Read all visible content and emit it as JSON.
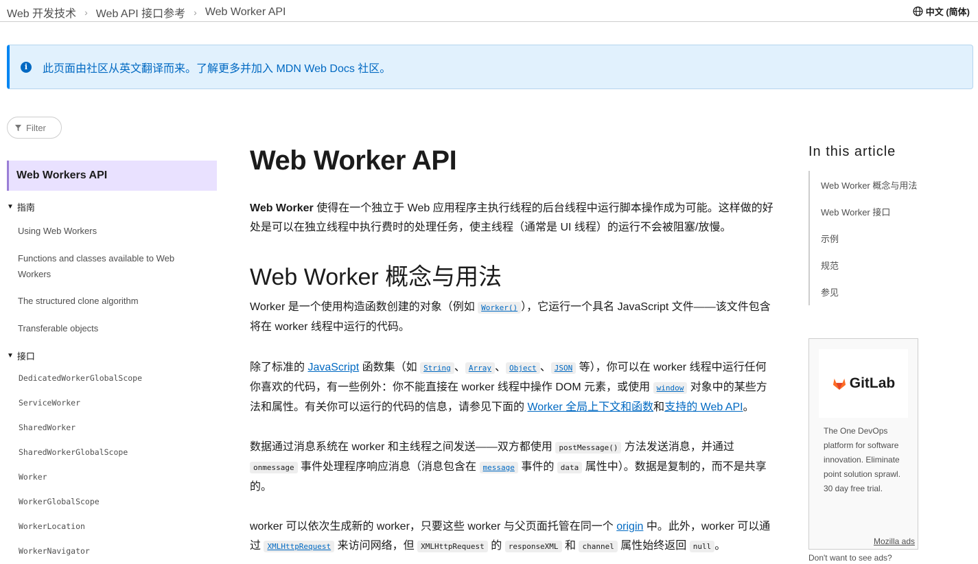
{
  "breadcrumb": [
    "Web 开发技术",
    "Web API 接口参考",
    "Web Worker API"
  ],
  "language": "中文 (简体)",
  "notice": "此页面由社区从英文翻译而来。了解更多并加入 MDN Web Docs 社区。",
  "filter_placeholder": "Filter",
  "sidebar": {
    "active": "Web Workers API",
    "guide_heading": "指南",
    "guide_links": [
      "Using Web Workers",
      "Functions and classes available to Web Workers",
      "The structured clone algorithm",
      "Transferable objects"
    ],
    "interfaces_heading": "接口",
    "interfaces": [
      "DedicatedWorkerGlobalScope",
      "ServiceWorker",
      "SharedWorker",
      "SharedWorkerGlobalScope",
      "Worker",
      "WorkerGlobalScope",
      "WorkerLocation",
      "WorkerNavigator"
    ]
  },
  "article": {
    "title": "Web Worker API",
    "intro_bold": "Web Worker",
    "intro_rest": " 使得在一个独立于 Web 应用程序主执行线程的后台线程中运行脚本操作成为可能。这样做的好处是可以在独立线程中执行费时的处理任务，使主线程（通常是 UI 线程）的运行不会被阻塞/放慢。",
    "h2": "Web Worker 概念与用法",
    "p1_a": "Worker 是一个使用构造函数创建的对象（例如 ",
    "p1_code": "Worker()",
    "p1_b": "），它运行一个具名 JavaScript 文件——该文件包含将在 worker 线程中运行的代码。",
    "p2_a": "除了标准的 ",
    "p2_js": "JavaScript",
    "p2_b": " 函数集（如 ",
    "p2_string": "String",
    "p2_array": "Array",
    "p2_object": "Object",
    "p2_json": "JSON",
    "p2_c": " 等），你可以在 worker 线程中运行任何你喜欢的代码，有一些例外：你不能直接在 worker 线程中操作 DOM 元素，或使用 ",
    "p2_window": "window",
    "p2_d": " 对象中的某些方法和属性。有关你可以运行的代码的信息，请参见下面的 ",
    "p2_link1": "Worker 全局上下文和函数",
    "p2_and": "和",
    "p2_link2": "支持的 Web API",
    "p2_e": "。",
    "p3_a": "数据通过消息系统在 worker 和主线程之间发送——双方都使用 ",
    "p3_post": "postMessage()",
    "p3_b": " 方法发送消息，并通过 ",
    "p3_onmsg": "onmessage",
    "p3_c": " 事件处理程序响应消息（消息包含在 ",
    "p3_message": "message",
    "p3_d": " 事件的 ",
    "p3_data": "data",
    "p3_e": " 属性中）。数据是复制的，而不是共享的。",
    "p4_a": "worker 可以依次生成新的 worker，只要这些 worker 与父页面托管在同一个 ",
    "p4_origin": "origin",
    "p4_b": " 中。此外，worker 可以通过 ",
    "p4_xhr": "XMLHttpRequest",
    "p4_c": " 来访问网络，但 ",
    "p4_xhr2": "XMLHttpRequest",
    "p4_d": " 的 ",
    "p4_resp": "responseXML",
    "p4_e": " 和 ",
    "p4_channel": "channel",
    "p4_f": " 属性始终返回 ",
    "p4_null": "null",
    "p4_g": "。"
  },
  "toc": {
    "title": "In this article",
    "items": [
      "Web Worker 概念与用法",
      "Web Worker 接口",
      "示例",
      "规范",
      "参见"
    ]
  },
  "ad": {
    "brand": "GitLab",
    "text": "The One DevOps platform for software innovation. Eliminate point solution sprawl. 30 day free trial.",
    "link": "Mozilla ads",
    "no_ads": "Don't want to see ads?"
  },
  "colors": {
    "link": "#0069c2",
    "notice_bg": "#e1f1fd",
    "active_bg": "#e9e1ff",
    "gitlab": "#fc6d26"
  }
}
